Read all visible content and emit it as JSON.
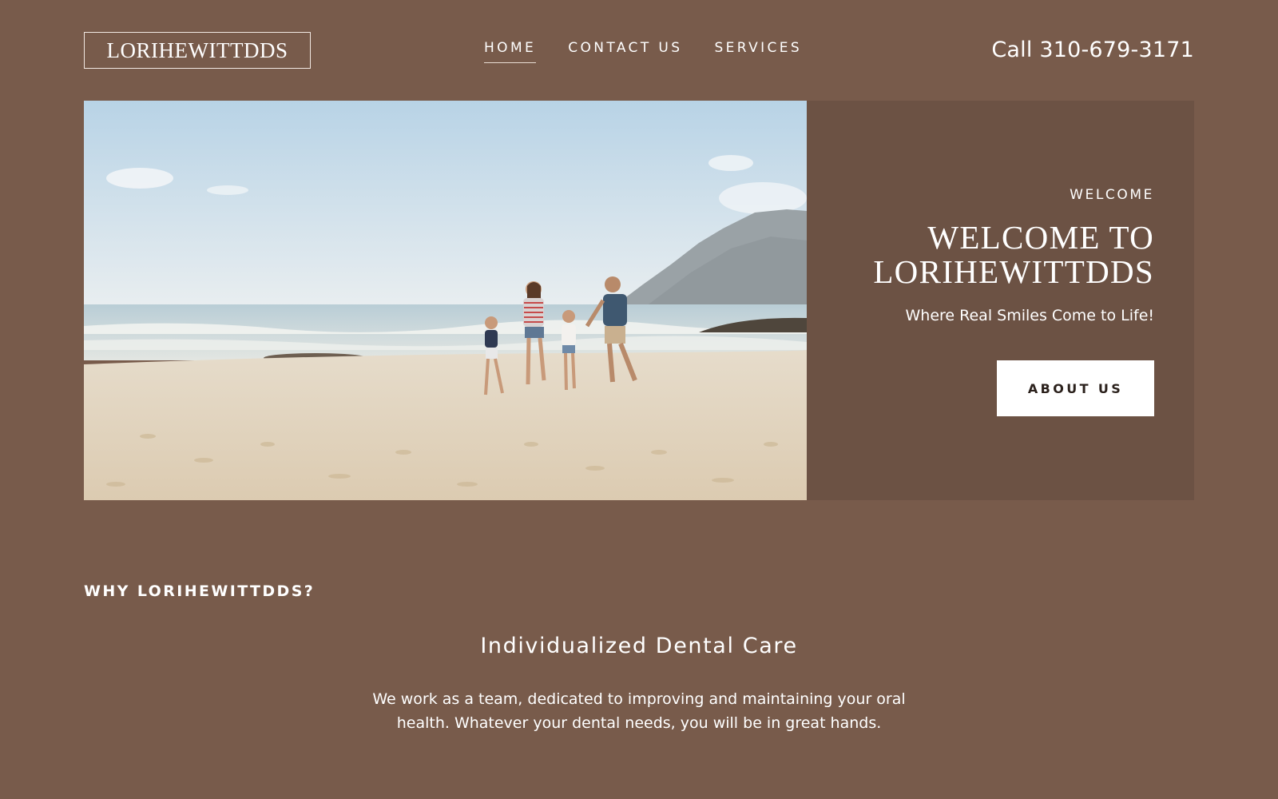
{
  "header": {
    "logo": "LORIHEWITTDDS",
    "nav": [
      {
        "label": "HOME",
        "active": true
      },
      {
        "label": "CONTACT US",
        "active": false
      },
      {
        "label": "SERVICES",
        "active": false
      }
    ],
    "phone": "Call 310-679-3171"
  },
  "hero": {
    "eyebrow": "WELCOME",
    "title": "WELCOME TO LORIHEWITTDDS",
    "tagline": "Where Real Smiles Come to Life!",
    "button_label": "ABOUT US"
  },
  "why": {
    "heading": "WHY LORIHEWITTDDS?",
    "feature_title": "Individualized Dental Care",
    "feature_text": "We work as a team, dedicated to improving and maintaining your oral health. Whatever your dental needs, you will be in great hands."
  },
  "colors": {
    "page_background": "#785b4b",
    "panel_background": "#6c5244",
    "button_background": "#ffffff",
    "button_text": "#2b211c"
  }
}
